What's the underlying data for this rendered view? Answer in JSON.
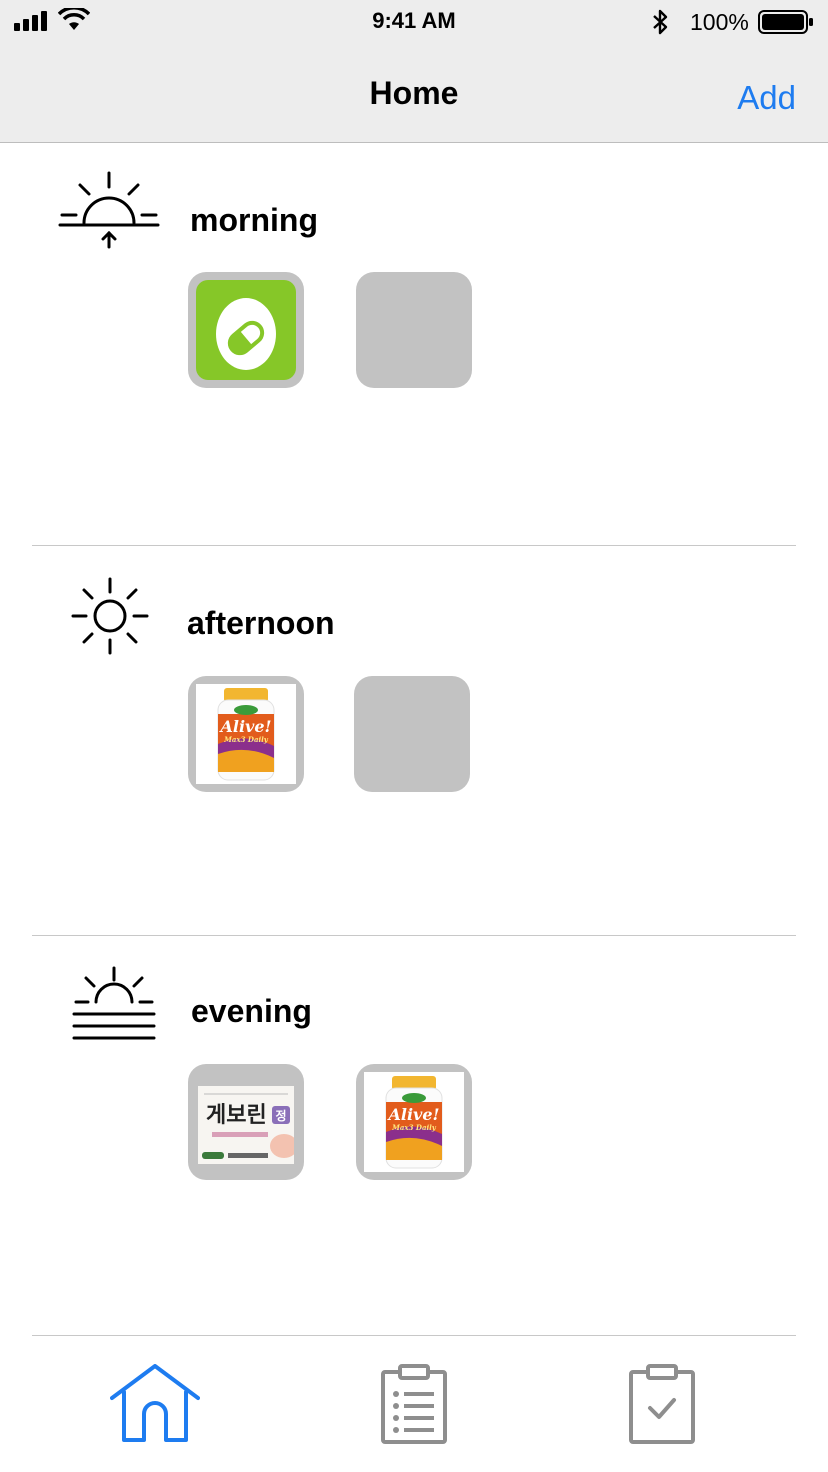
{
  "status_bar": {
    "time": "9:41 AM",
    "battery_percent": "100%",
    "icons": [
      "signal-icon",
      "wifi-icon",
      "bluetooth-icon",
      "battery-icon"
    ]
  },
  "nav": {
    "title": "Home",
    "add_label": "Add"
  },
  "sections": [
    {
      "label": "morning",
      "icon": "sunrise-icon",
      "slots": [
        {
          "state": "filled",
          "image": "pill-app-icon"
        },
        {
          "state": "empty"
        }
      ]
    },
    {
      "label": "afternoon",
      "icon": "sun-icon",
      "slots": [
        {
          "state": "filled",
          "image": "alive-multivitamin-bottle",
          "brand_text": "Alive!",
          "sub_text": "Max3 Daily"
        },
        {
          "state": "empty"
        }
      ]
    },
    {
      "label": "evening",
      "icon": "sunset-icon",
      "slots": [
        {
          "state": "filled",
          "image": "geborin-box",
          "brand_text": "게보린",
          "badge_text": "정"
        },
        {
          "state": "filled",
          "image": "alive-multivitamin-bottle",
          "brand_text": "Alive!",
          "sub_text": "Max3 Daily"
        }
      ]
    }
  ],
  "tab_bar": {
    "items": [
      {
        "name": "home",
        "icon": "home-icon",
        "active": true
      },
      {
        "name": "list",
        "icon": "clipboard-list-icon",
        "active": false
      },
      {
        "name": "check",
        "icon": "clipboard-check-icon",
        "active": false
      }
    ]
  },
  "colors": {
    "accent": "#1e7cf0",
    "bar_bg": "#ededed",
    "slot_bg": "#c2c2c2",
    "inactive_icon": "#8e8e8e",
    "pill_green": "#86c728"
  }
}
